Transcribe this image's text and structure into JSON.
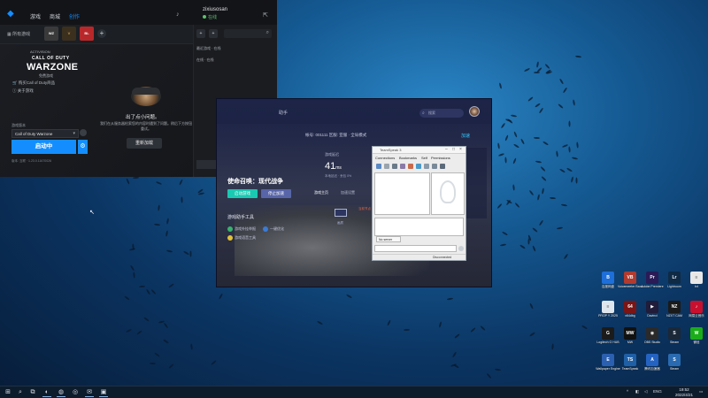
{
  "battlenet": {
    "nav": [
      "游戏",
      "商城",
      "创作"
    ],
    "user_name": "zixiusosan",
    "user_status": "在线",
    "all_games": "所有游戏",
    "game_tiles": [
      {
        "label": "WZ",
        "color": "#3a3a3a",
        "text_color": "#ffffff"
      },
      {
        "label": "V",
        "color": "#3b2f1e",
        "text_color": "#c9a14a"
      },
      {
        "label": "BL",
        "color": "#b8282a",
        "text_color": "#ffffff"
      }
    ],
    "wz_small": "ACTIVISION",
    "wz_cod": "CALL OF DUTY",
    "wz_title": "WARZONE",
    "wz_sub": "免费游戏",
    "links": [
      "购买Call of Duty商品",
      "关于游戏"
    ],
    "error_title": "出了点小问题。",
    "error_message": "我们在从服务器检索您的内容时遇到了问题。稍后下方按钮重试。",
    "reload_label": "重新加载",
    "version_label": "游戏版本",
    "version_value": "Call of Duty Warzone",
    "play_label": "启动中",
    "footer": "版本: 互联 · 1.23.0.11670026",
    "friend_groups": [
      "最近游戏 · 在线",
      "在线 · 在线"
    ],
    "chat_label": "聊天与群组"
  },
  "accelerator": {
    "title_prefix": "助手",
    "search_placeholder": "搜索",
    "info_bar": "帐号: 001111  区服: 亚服 · 全局模式",
    "accel_label": "加速",
    "latency_label": "游戏延迟",
    "latency_value": "41",
    "latency_unit": "ms",
    "sub_latency": "本地延迟 · 丢包 0%",
    "game_name": "使命召唤：现代战争",
    "btn_start": "启动游戏",
    "btn_stop": "停止加速",
    "tabs": [
      "游戏主页",
      "加速设置"
    ],
    "tools_title": "游戏助手工具",
    "tools": [
      "游戏外挂举报",
      "一键优化",
      "游戏语音工具"
    ],
    "monitor_label": "画质",
    "map_info": "当前节点 · 亚洲"
  },
  "teamspeak": {
    "title": "TeamSpeak 3",
    "menu": [
      "Connections",
      "Bookmarks",
      "Self",
      "Permissions"
    ],
    "chat_tab": "No server",
    "status": "Disconnected"
  },
  "desktop_icons": [
    {
      "label": "百度网盘",
      "color": "#1e6fd9",
      "glyph": "B"
    },
    {
      "label": "Voicemeeter Banana",
      "color": "#b23a2e",
      "glyph": "VB"
    },
    {
      "label": "Adobe Premiere",
      "color": "#2a1a56",
      "glyph": "Pr"
    },
    {
      "label": "Lightroom",
      "color": "#0f2a44",
      "glyph": "Lr"
    },
    {
      "label": "txt",
      "color": "#e8e8e8",
      "glyph": "≡"
    },
    {
      "label": "PROP Y 2025",
      "color": "#dfe6ee",
      "glyph": "≡"
    },
    {
      "label": "x64dbg",
      "color": "#7a1515",
      "glyph": "64"
    },
    {
      "label": "Davinci",
      "color": "#201c3a",
      "glyph": "▶"
    },
    {
      "label": "NZXT CAM",
      "color": "#1a1a1a",
      "glyph": "NZ"
    },
    {
      "label": "网易云音乐",
      "color": "#c8102e",
      "glyph": "♪"
    },
    {
      "label": "Logitech G HUB",
      "color": "#1b1b1b",
      "glyph": "G"
    },
    {
      "label": "MW",
      "color": "#111111",
      "glyph": "MW"
    },
    {
      "label": "OBS Studio",
      "color": "#2a2a2a",
      "glyph": "◉"
    },
    {
      "label": "Steam",
      "color": "#1b2838",
      "glyph": "S"
    },
    {
      "label": "微信",
      "color": "#1aad19",
      "glyph": "W"
    },
    {
      "label": "Wallpaper Engine",
      "color": "#2b5fb0",
      "glyph": "E"
    },
    {
      "label": "TeamSpeak",
      "color": "#1f5fa6",
      "glyph": "TS"
    },
    {
      "label": "腾讯加速器",
      "color": "#2563c2",
      "glyph": "A"
    },
    {
      "label": "Steam",
      "color": "#2a6ab0",
      "glyph": "S"
    }
  ],
  "taskbar": {
    "icons": [
      "⊞",
      "⌕",
      "⧉",
      "◐",
      "◍",
      "◎",
      "✉",
      "▣"
    ],
    "tray_lang": "ENG",
    "time": "19:52",
    "date": "2022/4/21"
  },
  "colors": {
    "bnet_accent": "#148eff",
    "accelerator_accent": "#1ac9b1",
    "desktop": "#155a93"
  }
}
